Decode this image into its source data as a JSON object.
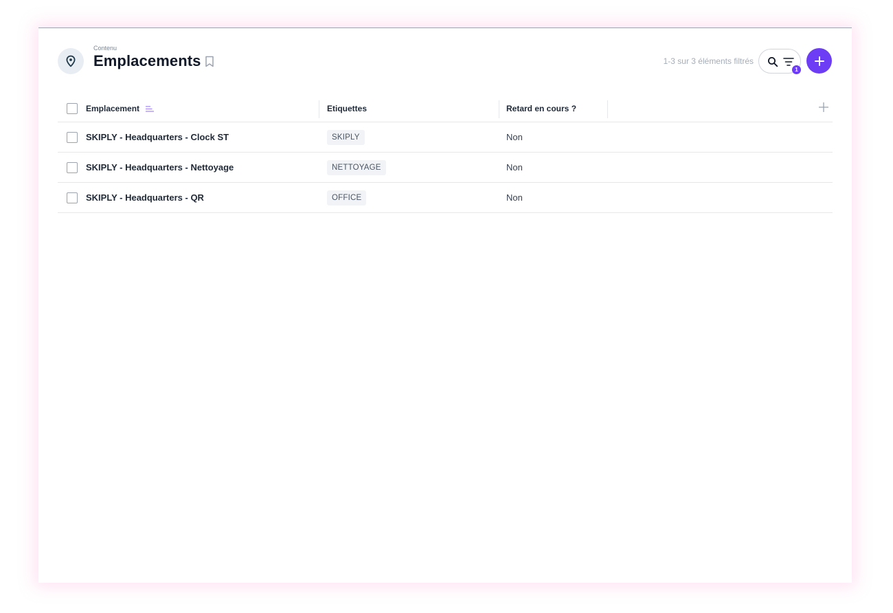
{
  "header": {
    "breadcrumb": "Contenu",
    "title": "Emplacements",
    "count_text": "1-3 sur 3 éléments filtrés",
    "filter_count": "1",
    "icons": {
      "page": "map-pin-icon",
      "bookmark": "bookmark-icon",
      "search": "search-icon",
      "filter": "filter-icon",
      "add": "plus-icon"
    }
  },
  "table": {
    "columns": [
      "Emplacement",
      "Etiquettes",
      "Retard en cours ?"
    ],
    "rows": [
      {
        "name": "SKIPLY - Headquarters - Clock ST",
        "tag": "SKIPLY",
        "late": "Non"
      },
      {
        "name": "SKIPLY - Headquarters - Nettoyage",
        "tag": "NETTOYAGE",
        "late": "Non"
      },
      {
        "name": "SKIPLY - Headquarters - QR",
        "tag": "OFFICE",
        "late": "Non"
      }
    ]
  },
  "colors": {
    "accent": "#6d3cf5",
    "icon_bg": "#e8edf3",
    "muted_text": "#a3adba",
    "tag_bg": "#f1f3f6"
  }
}
